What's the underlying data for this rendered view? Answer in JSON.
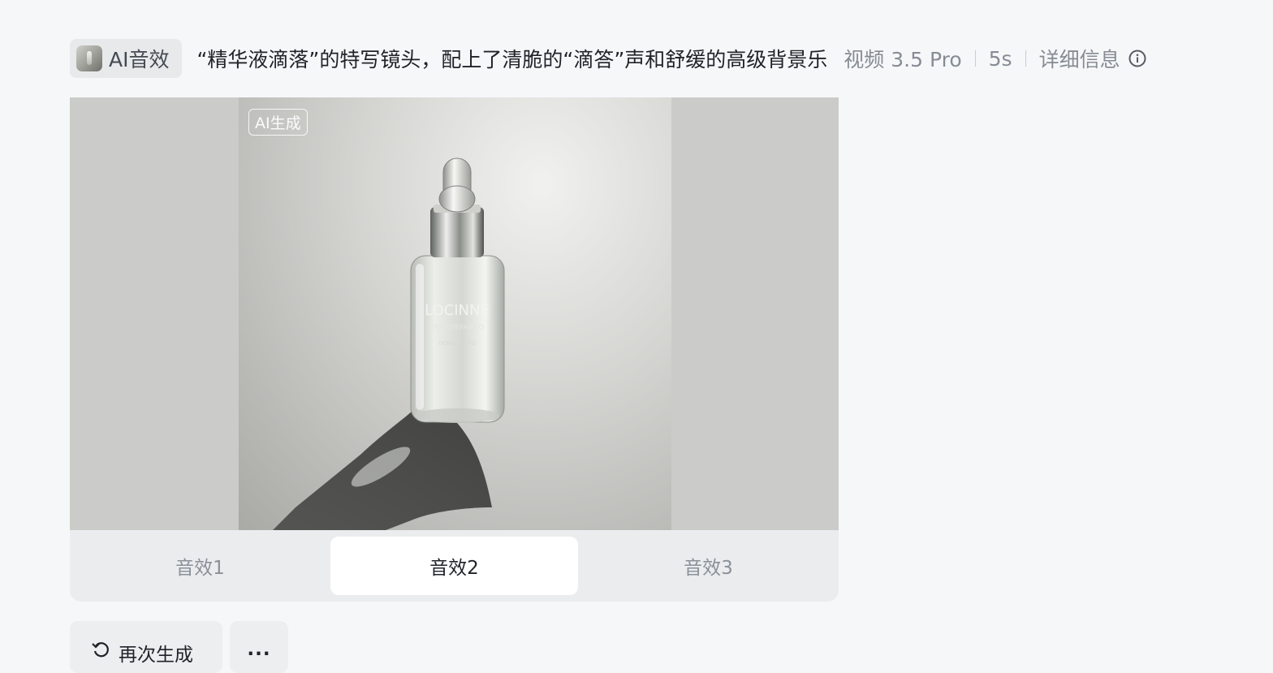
{
  "header": {
    "chip_label": "AI音效",
    "prompt": "“精华液滴落”的特写镜头，配上了清脆的“滴答”声和舒缓的高级背景乐",
    "model": "视频 3.5 Pro",
    "duration": "5s",
    "details": "详细信息"
  },
  "video": {
    "ai_badge": "AI生成",
    "bottle_text_1": "LOCINNE",
    "bottle_text_2": "FRNCUEFANCO",
    "bottle_text_3": "GONLÉR NFO"
  },
  "tabs": [
    {
      "label": "音效1",
      "active": false
    },
    {
      "label": "音效2",
      "active": true
    },
    {
      "label": "音效3",
      "active": false
    }
  ],
  "actions": {
    "regenerate": "再次生成",
    "more": "..."
  },
  "icons": {
    "regenerate": "refresh-icon",
    "info": "info-circle-icon",
    "more": "more-horizontal-icon"
  }
}
